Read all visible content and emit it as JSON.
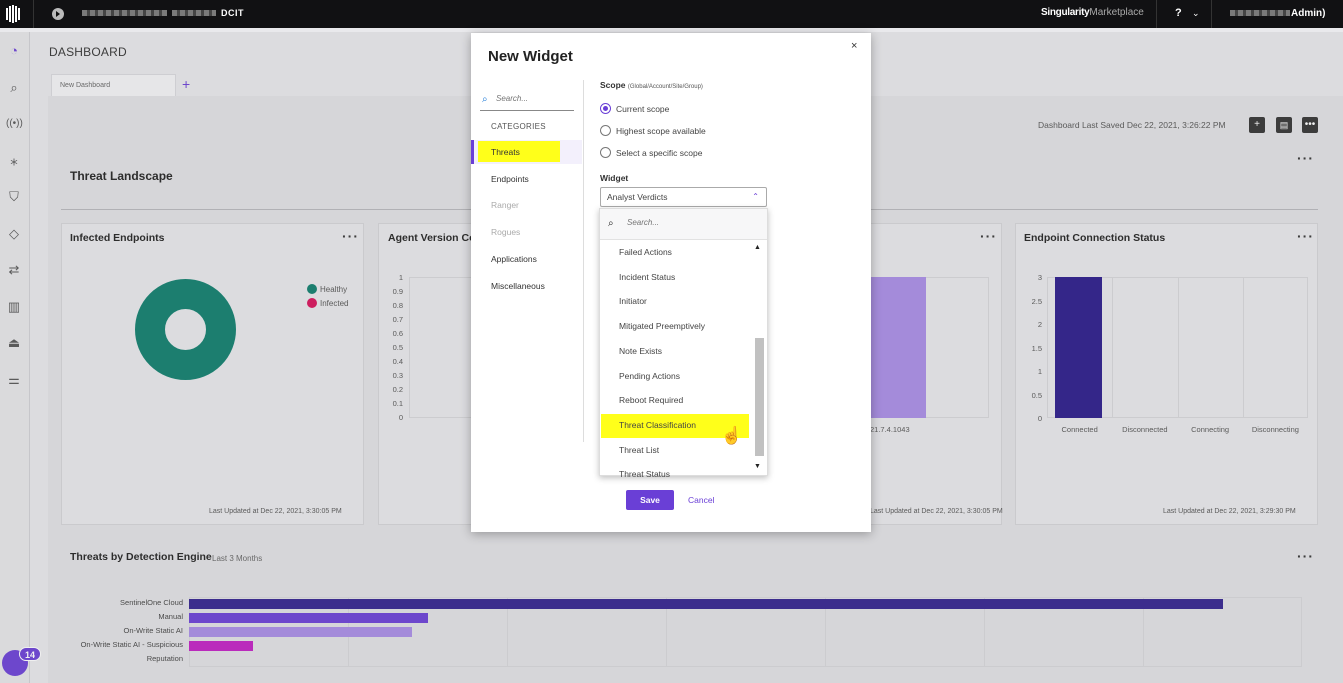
{
  "topbar": {
    "site_suffix": "DCIT",
    "marketplace_brand": "Singularity",
    "marketplace_word": "Marketplace",
    "help": "?",
    "user_suffix": "Admin)"
  },
  "sidebar": {
    "badge_count": "14",
    "icons": [
      "dashboard-icon",
      "search-icon",
      "broadcast-icon",
      "asterisk-icon",
      "shield-icon",
      "diamond-icon",
      "sync-icon",
      "bar-chart-icon",
      "stamp-icon",
      "sliders-icon"
    ]
  },
  "dashboard": {
    "title": "DASHBOARD",
    "tab": "New Dashboard",
    "last_saved": "Dashboard Last Saved Dec 22, 2021, 3:26:22 PM",
    "sections": {
      "threat_landscape": "Threat Landscape",
      "threats_by_engine": "Threats by Detection Engine",
      "threats_by_engine_sub": "Last 3 Months"
    },
    "cards": {
      "infected": {
        "title": "Infected Endpoints",
        "legend": [
          "Healthy",
          "Infected"
        ],
        "footer": "Last Updated at Dec 22, 2021, 3:30:05 PM",
        "colors": {
          "healthy": "#0e7e6d",
          "infected": "#d8115a"
        }
      },
      "agent_version": {
        "title": "Agent Version Co",
        "footer": "Last Updated at Dec 22, 2021, 3:30:05 PM",
        "x_label_partial": "21.7.4.1043"
      },
      "connection": {
        "title": "Endpoint Connection Status",
        "footer": "Last Updated at Dec 22, 2021, 3:29:30 PM"
      }
    }
  },
  "modal": {
    "title": "New Widget",
    "close": "×",
    "category_search_placeholder": "Search...",
    "categories_header": "CATEGORIES",
    "categories": [
      {
        "label": "Threats",
        "state": "active"
      },
      {
        "label": "Endpoints",
        "state": "normal"
      },
      {
        "label": "Ranger",
        "state": "disabled"
      },
      {
        "label": "Rogues",
        "state": "disabled"
      },
      {
        "label": "Applications",
        "state": "normal"
      },
      {
        "label": "Miscellaneous",
        "state": "normal"
      }
    ],
    "scope_label": "Scope",
    "scope_hint": "(Global/Account/Site/Group)",
    "scope_options": [
      {
        "label": "Current scope",
        "checked": true
      },
      {
        "label": "Highest scope available",
        "checked": false
      },
      {
        "label": "Select a specific scope",
        "checked": false
      }
    ],
    "widget_label": "Widget",
    "widget_selected": "Analyst Verdicts",
    "dropdown_search_placeholder": "Search...",
    "dropdown_items": [
      "Failed Actions",
      "Incident Status",
      "Initiator",
      "Mitigated Preemptively",
      "Note Exists",
      "Pending Actions",
      "Reboot Required",
      "Threat Classification",
      "Threat List",
      "Threat Status"
    ],
    "dropdown_highlighted": "Threat Classification",
    "save": "Save",
    "cancel": "Cancel"
  },
  "chart_data": [
    {
      "type": "pie",
      "title": "Infected Endpoints",
      "categories": [
        "Healthy",
        "Infected"
      ],
      "values": [
        100,
        0
      ]
    },
    {
      "type": "bar",
      "title": "Agent Version Co",
      "categories": [
        "21.7.4.1043"
      ],
      "values": [
        1
      ],
      "ylim": [
        0,
        1
      ],
      "yticks": [
        "1",
        "0.9",
        "0.8",
        "0.7",
        "0.6",
        "0.5",
        "0.4",
        "0.3",
        "0.2",
        "0.1",
        "0"
      ]
    },
    {
      "type": "bar",
      "title": "Endpoint Connection Status",
      "categories": [
        "Connected",
        "Disconnected",
        "Connecting",
        "Disconnecting"
      ],
      "values": [
        3,
        0,
        0,
        0
      ],
      "ylim": [
        0,
        3
      ],
      "yticks": [
        "3",
        "2.5",
        "2",
        "1.5",
        "1",
        "0.5",
        "0"
      ]
    },
    {
      "type": "bar",
      "orientation": "horizontal",
      "title": "Threats by Detection Engine",
      "categories": [
        "SentinelOne Cloud",
        "Manual",
        "On-Write Static AI",
        "On-Write Static AI - Suspicious",
        "Reputation"
      ],
      "values": [
        65,
        15,
        14,
        4,
        0
      ],
      "colors": [
        "#33228f",
        "#6a3fd6",
        "#a98de6",
        "#c21fc4",
        "#cccccc"
      ]
    }
  ]
}
